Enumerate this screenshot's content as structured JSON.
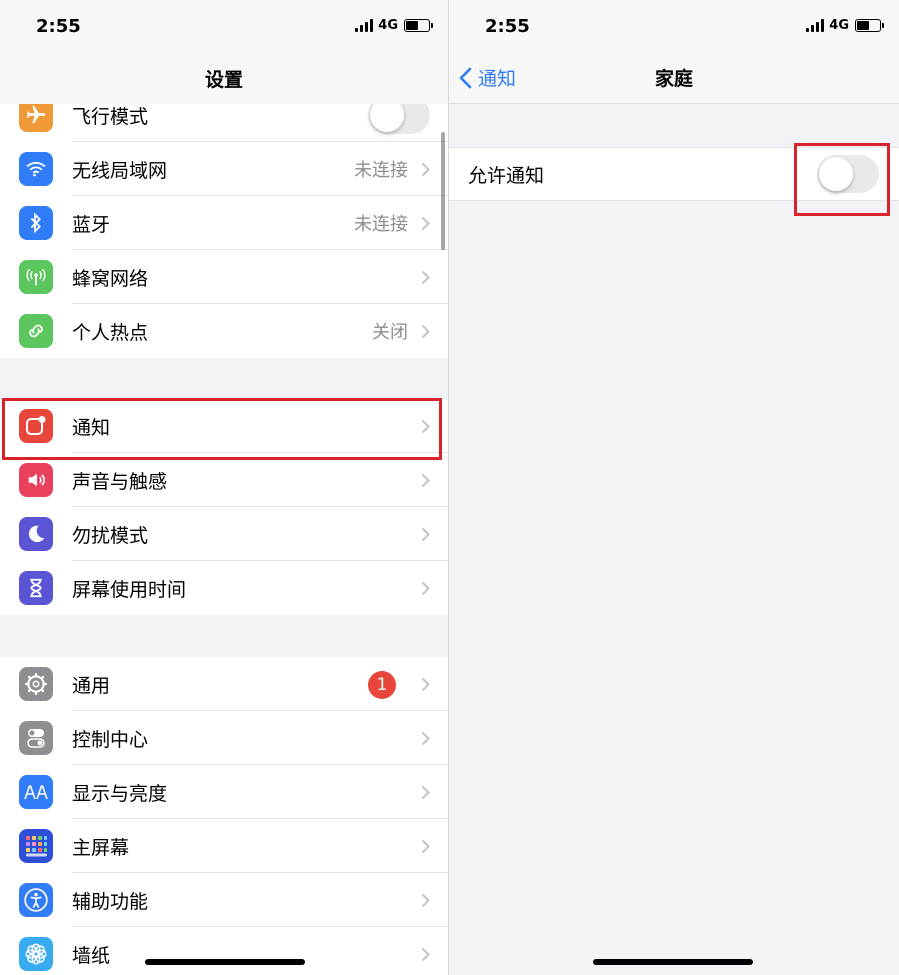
{
  "status": {
    "time": "2:55",
    "network": "4G"
  },
  "left_screen": {
    "title": "设置",
    "group1": [
      {
        "label": "飞行模式",
        "value": "",
        "icon": "airplane-icon",
        "color": "#f09a37"
      },
      {
        "label": "无线局域网",
        "value": "未连接",
        "icon": "wifi-icon",
        "color": "#2f7cf6"
      },
      {
        "label": "蓝牙",
        "value": "未连接",
        "icon": "bluetooth-icon",
        "color": "#2f7cf6"
      },
      {
        "label": "蜂窝网络",
        "value": "",
        "icon": "antenna-icon",
        "color": "#5ac65d"
      },
      {
        "label": "个人热点",
        "value": "关闭",
        "icon": "hotspot-icon",
        "color": "#5ac65d"
      }
    ],
    "group2": [
      {
        "label": "通知",
        "icon": "notification-icon",
        "color": "#e9463b"
      },
      {
        "label": "声音与触感",
        "icon": "speaker-icon",
        "color": "#e9405e"
      },
      {
        "label": "勿扰模式",
        "icon": "moon-icon",
        "color": "#5b55d6"
      },
      {
        "label": "屏幕使用时间",
        "icon": "hourglass-icon",
        "color": "#5b55d6"
      }
    ],
    "group3": [
      {
        "label": "通用",
        "badge": "1",
        "icon": "gear-icon",
        "color": "#8e8e93"
      },
      {
        "label": "控制中心",
        "icon": "switches-icon",
        "color": "#8e8e93"
      },
      {
        "label": "显示与亮度",
        "icon": "text-size-icon",
        "color": "#2f7cf6"
      },
      {
        "label": "主屏幕",
        "icon": "home-grid-icon",
        "color": "#2d4fd6"
      },
      {
        "label": "辅助功能",
        "icon": "accessibility-icon",
        "color": "#2f7cf6"
      },
      {
        "label": "墙纸",
        "icon": "flower-icon",
        "color": "#38aaef"
      }
    ]
  },
  "right_screen": {
    "back_label": "通知",
    "title": "家庭",
    "row_label": "允许通知"
  },
  "colors": {
    "accent": "#2f7cf6",
    "highlight": "#d8232c",
    "background": "#f2f2f7"
  }
}
